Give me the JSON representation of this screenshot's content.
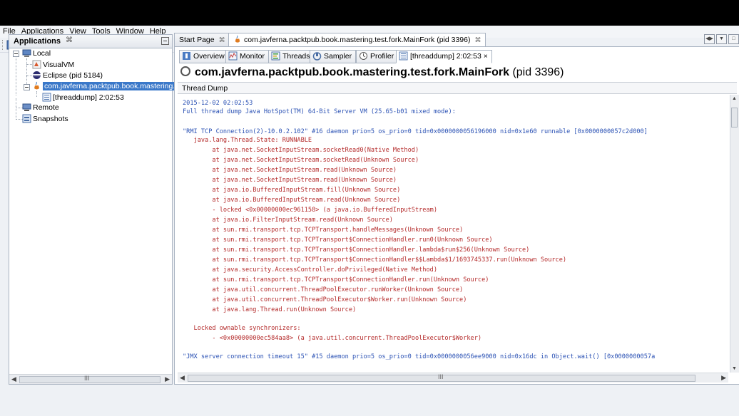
{
  "menu": [
    "File",
    "Applications",
    "View",
    "Tools",
    "Window",
    "Help"
  ],
  "left_panel": {
    "title": "Applications",
    "close": "⌘",
    "tree": {
      "local": "Local",
      "visualvm": "VisualVM",
      "eclipse": "Eclipse (pid 5184)",
      "mainfork": "com.javferna.packtpub.book.mastering.te",
      "threaddump": "[threaddump] 2:02:53",
      "remote": "Remote",
      "snapshots": "Snapshots"
    },
    "scroll_grip": "III"
  },
  "doc_tabs": {
    "start_page": "Start Page",
    "start_close": "⌘",
    "mainfork": "com.javferna.packtpub.book.mastering.test.fork.MainFork (pid 3396)",
    "mainfork_close": "⌘"
  },
  "sub_tabs": {
    "overview": "Overview",
    "monitor": "Monitor",
    "threads": "Threads",
    "sampler": "Sampler",
    "profiler": "Profiler",
    "threaddump": "[threaddump] 2:02:53",
    "threaddump_close": "×"
  },
  "heading": {
    "name": "com.javferna.packtpub.book.mastering.test.fork.MainFork",
    "pid": "(pid 3396)"
  },
  "section_title": "Thread Dump",
  "dump_lines": [
    {
      "text": "2015-12-02 02:02:53",
      "color": "blue"
    },
    {
      "text": "Full thread dump Java HotSpot(TM) 64-Bit Server VM (25.65-b01 mixed mode):",
      "color": "blue"
    },
    {
      "text": "",
      "color": "blue"
    },
    {
      "text": "\"RMI TCP Connection(2)-10.0.2.102\" #16 daemon prio=5 os_prio=0 tid=0x0000000056196000 nid=0x1e60 runnable [0x0000000057c2d000]",
      "color": "blue"
    },
    {
      "text": "   java.lang.Thread.State: RUNNABLE",
      "color": "red"
    },
    {
      "text": "        at java.net.SocketInputStream.socketRead0(Native Method)",
      "color": "red"
    },
    {
      "text": "        at java.net.SocketInputStream.socketRead(Unknown Source)",
      "color": "red"
    },
    {
      "text": "        at java.net.SocketInputStream.read(Unknown Source)",
      "color": "red"
    },
    {
      "text": "        at java.net.SocketInputStream.read(Unknown Source)",
      "color": "red"
    },
    {
      "text": "        at java.io.BufferedInputStream.fill(Unknown Source)",
      "color": "red"
    },
    {
      "text": "        at java.io.BufferedInputStream.read(Unknown Source)",
      "color": "red"
    },
    {
      "text": "        - locked <0x00000000ec961158> (a java.io.BufferedInputStream)",
      "color": "red"
    },
    {
      "text": "        at java.io.FilterInputStream.read(Unknown Source)",
      "color": "red"
    },
    {
      "text": "        at sun.rmi.transport.tcp.TCPTransport.handleMessages(Unknown Source)",
      "color": "red"
    },
    {
      "text": "        at sun.rmi.transport.tcp.TCPTransport$ConnectionHandler.run0(Unknown Source)",
      "color": "red"
    },
    {
      "text": "        at sun.rmi.transport.tcp.TCPTransport$ConnectionHandler.lambda$run$256(Unknown Source)",
      "color": "red"
    },
    {
      "text": "        at sun.rmi.transport.tcp.TCPTransport$ConnectionHandler$$Lambda$1/1693745337.run(Unknown Source)",
      "color": "red"
    },
    {
      "text": "        at java.security.AccessController.doPrivileged(Native Method)",
      "color": "red"
    },
    {
      "text": "        at sun.rmi.transport.tcp.TCPTransport$ConnectionHandler.run(Unknown Source)",
      "color": "red"
    },
    {
      "text": "        at java.util.concurrent.ThreadPoolExecutor.runWorker(Unknown Source)",
      "color": "red"
    },
    {
      "text": "        at java.util.concurrent.ThreadPoolExecutor$Worker.run(Unknown Source)",
      "color": "red"
    },
    {
      "text": "        at java.lang.Thread.run(Unknown Source)",
      "color": "red"
    },
    {
      "text": "",
      "color": "red"
    },
    {
      "text": "   Locked ownable synchronizers:",
      "color": "red"
    },
    {
      "text": "        - <0x00000000ec584aa8> (a java.util.concurrent.ThreadPoolExecutor$Worker)",
      "color": "red"
    },
    {
      "text": "",
      "color": "red"
    },
    {
      "text": "\"JMX server connection timeout 15\" #15 daemon prio=5 os_prio=0 tid=0x0000000056ee9000 nid=0x16dc in Object.wait() [0x0000000057a",
      "color": "blue"
    }
  ],
  "colors": {
    "blue": "#2a51b4",
    "red": "#b42a2a",
    "selection": "#3a78c9"
  }
}
